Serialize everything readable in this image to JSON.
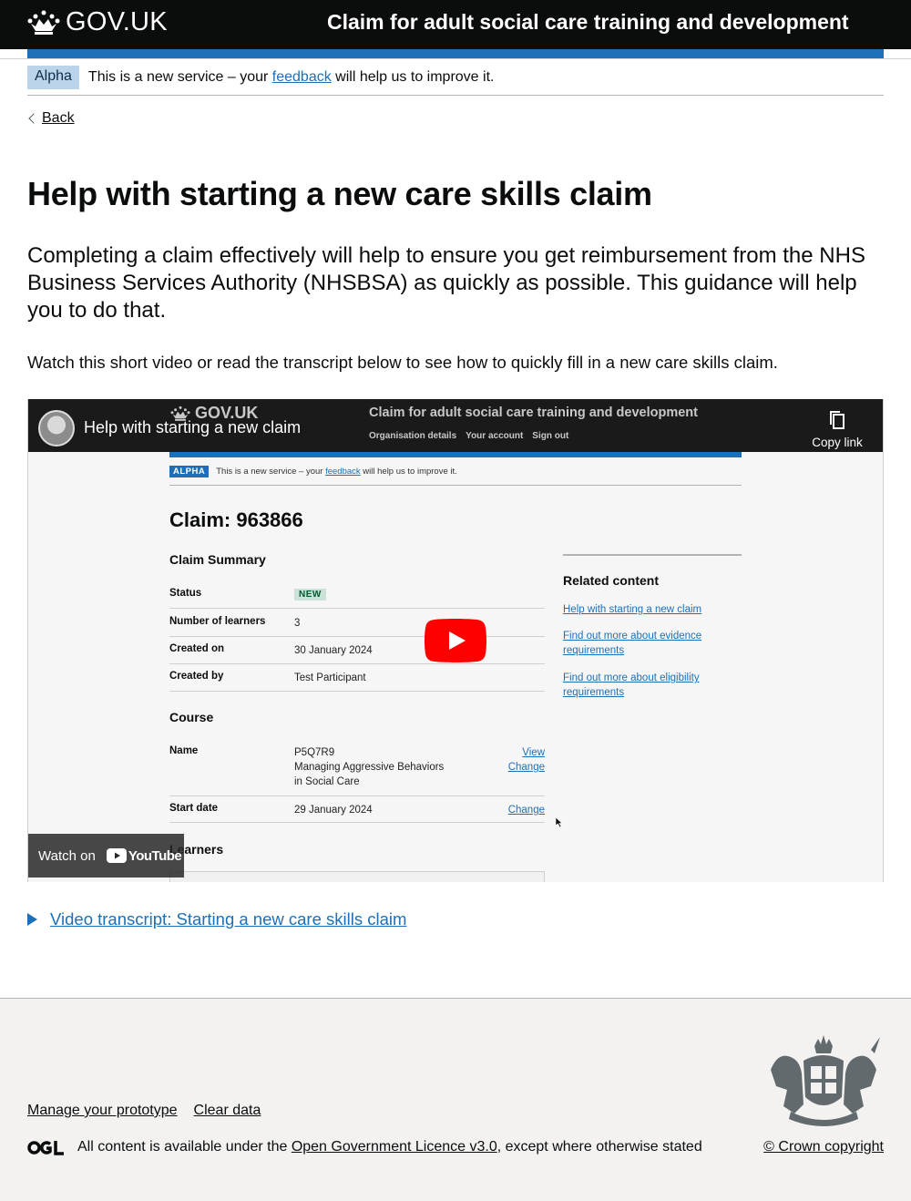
{
  "header": {
    "logo_text": "GOV.UK",
    "service_name": "Claim for adult social care training and development"
  },
  "phase_banner": {
    "tag": "Alpha",
    "text_before": "This is a new service – your ",
    "link": "feedback",
    "text_after": " will help us to improve it."
  },
  "back_link": "Back",
  "page": {
    "title": "Help with starting a new care skills claim",
    "lead": "Completing a claim effectively will help to ensure you get reimbursement from the NHS Business Services Authority (NHSBSA) as quickly as possible. This guidance will help you to do that.",
    "intro": "Watch this short video or read the transcript below to see how to quickly fill in a new care skills claim."
  },
  "video": {
    "title": "Help with starting a new claim",
    "copy_link": "Copy link",
    "watch_on": "Watch on",
    "youtube": "YouTube",
    "frame": {
      "logo_text": "GOV.UK",
      "service_name": "Claim for adult social care training and development",
      "nav": [
        "Organisation details",
        "Your account",
        "Sign out"
      ],
      "phase_tag": "ALPHA",
      "phase_before": "This is a new service – your ",
      "phase_link": "feedback",
      "phase_after": " will help us to improve it.",
      "claim_title": "Claim: 963866",
      "summary_heading": "Claim Summary",
      "status_key": "Status",
      "status_value": "NEW",
      "learners_key": "Number of learners",
      "learners_value": "3",
      "created_on_key": "Created on",
      "created_on_value": "30 January 2024",
      "created_by_key": "Created by",
      "created_by_value": "Test Participant",
      "course_heading": "Course",
      "name_key": "Name",
      "name_value_1": "P5Q7R9",
      "name_value_2": "Managing Aggressive Behaviors",
      "name_value_3": "in Social Care",
      "view_link": "View",
      "change_link": "Change",
      "start_date_key": "Start date",
      "start_date_value": "29 January 2024",
      "learners_heading": "Learners",
      "related_heading": "Related content",
      "related_links": [
        "Help with starting a new claim",
        "Find out more about evidence requirements",
        "Find out more about eligibility requirements"
      ]
    }
  },
  "details_summary": "Video transcript: Starting a new care skills claim",
  "footer": {
    "links": [
      "Manage your prototype",
      "Clear data"
    ],
    "ogl_logo": "OGL",
    "licence_before": "All content is available under the ",
    "licence_link": "Open Government Licence v3.0",
    "licence_after": ", except where otherwise stated",
    "copyright": "© Crown copyright"
  },
  "colors": {
    "header_bg": "#0b0c0c",
    "link": "#1d70b8",
    "phase_tag_bg": "#bbd4ea",
    "footer_bg": "#f3f2f1",
    "youtube_red": "#ff0000"
  }
}
